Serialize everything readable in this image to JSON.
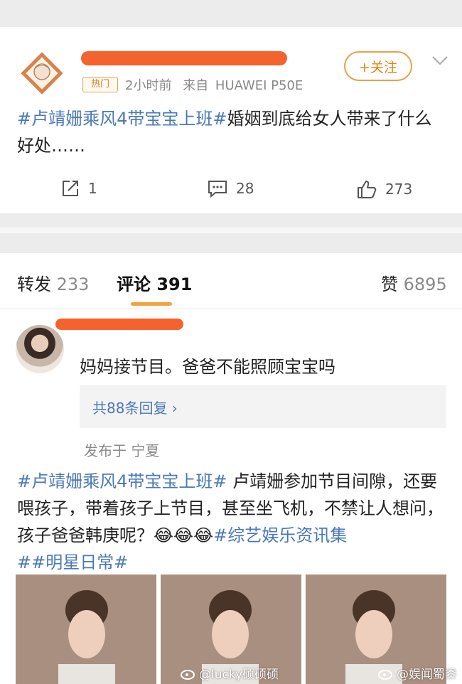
{
  "post": {
    "hot_badge": "热门",
    "time": "2小时前",
    "source_prefix": "来自",
    "source_device": "HUAWEI P50E",
    "follow_label": "+关注",
    "hashtag": "#卢靖姗乘风4带宝宝上班#",
    "text": "婚姻到底给女人带来了什么好处……",
    "actions": {
      "repost_count": "1",
      "comment_count": "28",
      "like_count": "273"
    }
  },
  "tabs": {
    "repost_label": "转发",
    "repost_count": "233",
    "comment_label": "评论",
    "comment_count": "391",
    "like_label": "赞",
    "like_count": "6895"
  },
  "comment": {
    "text": "妈妈接节目。爸爸不能照顾宝宝吗",
    "replies_label": "共88条回复 ›",
    "location": "发布于 宁夏"
  },
  "second_post": {
    "hashtag1": "#卢靖姗乘风4带宝宝上班#",
    "body": " 卢靖姗参加节目间隙，还要喂孩子，带着孩子上节目，甚至坐飞机，不禁让人想问，孩子爸爸韩庚呢？😂😂😂",
    "hashtag2": "#综艺娱乐资讯集",
    "hashtag3": "##明星日常#"
  },
  "watermarks": {
    "left": "@lucky硕硕硕",
    "right": "@娱闻蜀黍"
  },
  "colors": {
    "link": "#4a79b7",
    "accent": "#f2a33a",
    "redaction": "#f4622d"
  }
}
